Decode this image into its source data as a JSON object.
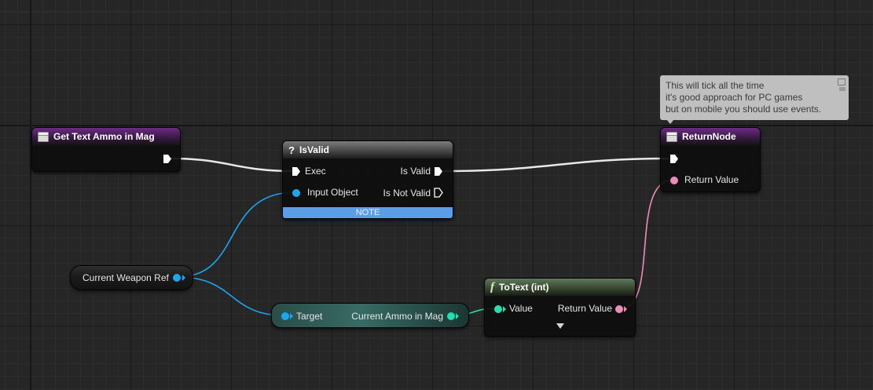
{
  "comment": {
    "lines": [
      "This will tick all the time",
      "it's good approach for PC games",
      "but on mobile you should use events."
    ]
  },
  "nodes": {
    "get_text_ammo": {
      "title": "Get Text Ammo in Mag"
    },
    "is_valid": {
      "title": "IsValid",
      "exec_in": "Exec",
      "input_object": "Input Object",
      "is_valid_out": "Is Valid",
      "is_not_valid_out": "Is Not Valid",
      "note": "NOTE"
    },
    "return_node": {
      "title": "ReturnNode",
      "return_value": "Return Value"
    },
    "current_weapon_ref": {
      "label": "Current Weapon Ref"
    },
    "ammo_getter": {
      "target": "Target",
      "output": "Current Ammo in Mag"
    },
    "to_text": {
      "title": "ToText (int)",
      "value": "Value",
      "return_value": "Return Value"
    }
  },
  "colors": {
    "function_header": "#6d2b85",
    "macro_header": "#7c7c7c",
    "pure_function_header": "#60795c",
    "object_pin": "#1aa6f2",
    "text_pin": "#f08ab8",
    "integer_pin": "#1ee0b0",
    "exec_wire": "#ffffff",
    "note_bar": "#5b9de6",
    "comment_bg": "#bfbfbf"
  }
}
